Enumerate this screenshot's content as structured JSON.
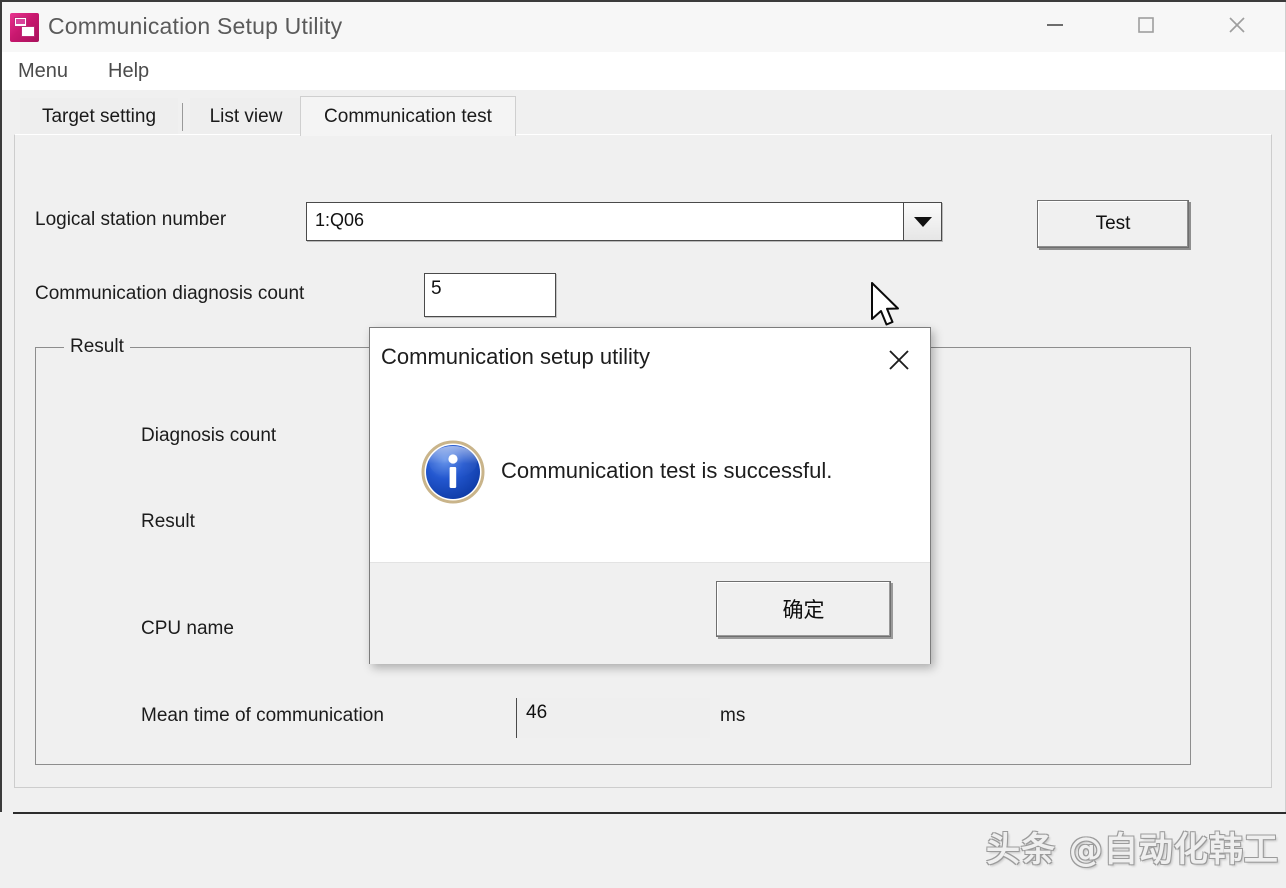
{
  "window": {
    "title": "Communication Setup Utility",
    "icon": "app-icon",
    "controls": {
      "minimize": "minimize-icon",
      "maximize": "maximize-icon",
      "close": "close-icon"
    }
  },
  "menubar": {
    "items": [
      {
        "label": "Menu"
      },
      {
        "label": "Help"
      }
    ]
  },
  "tabs": [
    {
      "label": "Target setting",
      "active": false
    },
    {
      "label": "List view",
      "active": false
    },
    {
      "label": "Communication test",
      "active": true
    }
  ],
  "form": {
    "logical_station": {
      "label": "Logical station number",
      "value": "1:Q06",
      "caret_icon": "chevron-down-icon"
    },
    "diagnosis_count": {
      "label": "Communication diagnosis count",
      "value": "5"
    },
    "test_button": "Test"
  },
  "result_group": {
    "title": "Result",
    "rows": [
      {
        "label": "Diagnosis count",
        "value": "",
        "unit": ""
      },
      {
        "label": "Result",
        "value": "",
        "unit": ""
      },
      {
        "label": "CPU name",
        "value": "",
        "unit": ""
      },
      {
        "label": "Mean time of communication",
        "value": "46",
        "unit": "ms"
      }
    ]
  },
  "dialog": {
    "title": "Communication setup utility",
    "close_icon": "close-icon",
    "info_icon": "info-icon",
    "message": "Communication test is successful.",
    "ok_button": "确定"
  },
  "watermark": "头条 @自动化韩工",
  "colors": {
    "window_bg": "#f0f0f0",
    "titlebar_bg": "#f7f7f7",
    "accent_icon": "#d0197a",
    "info_blue": "#1b54c8",
    "info_ring": "#c9b48a",
    "border": "#4a4a4a"
  }
}
